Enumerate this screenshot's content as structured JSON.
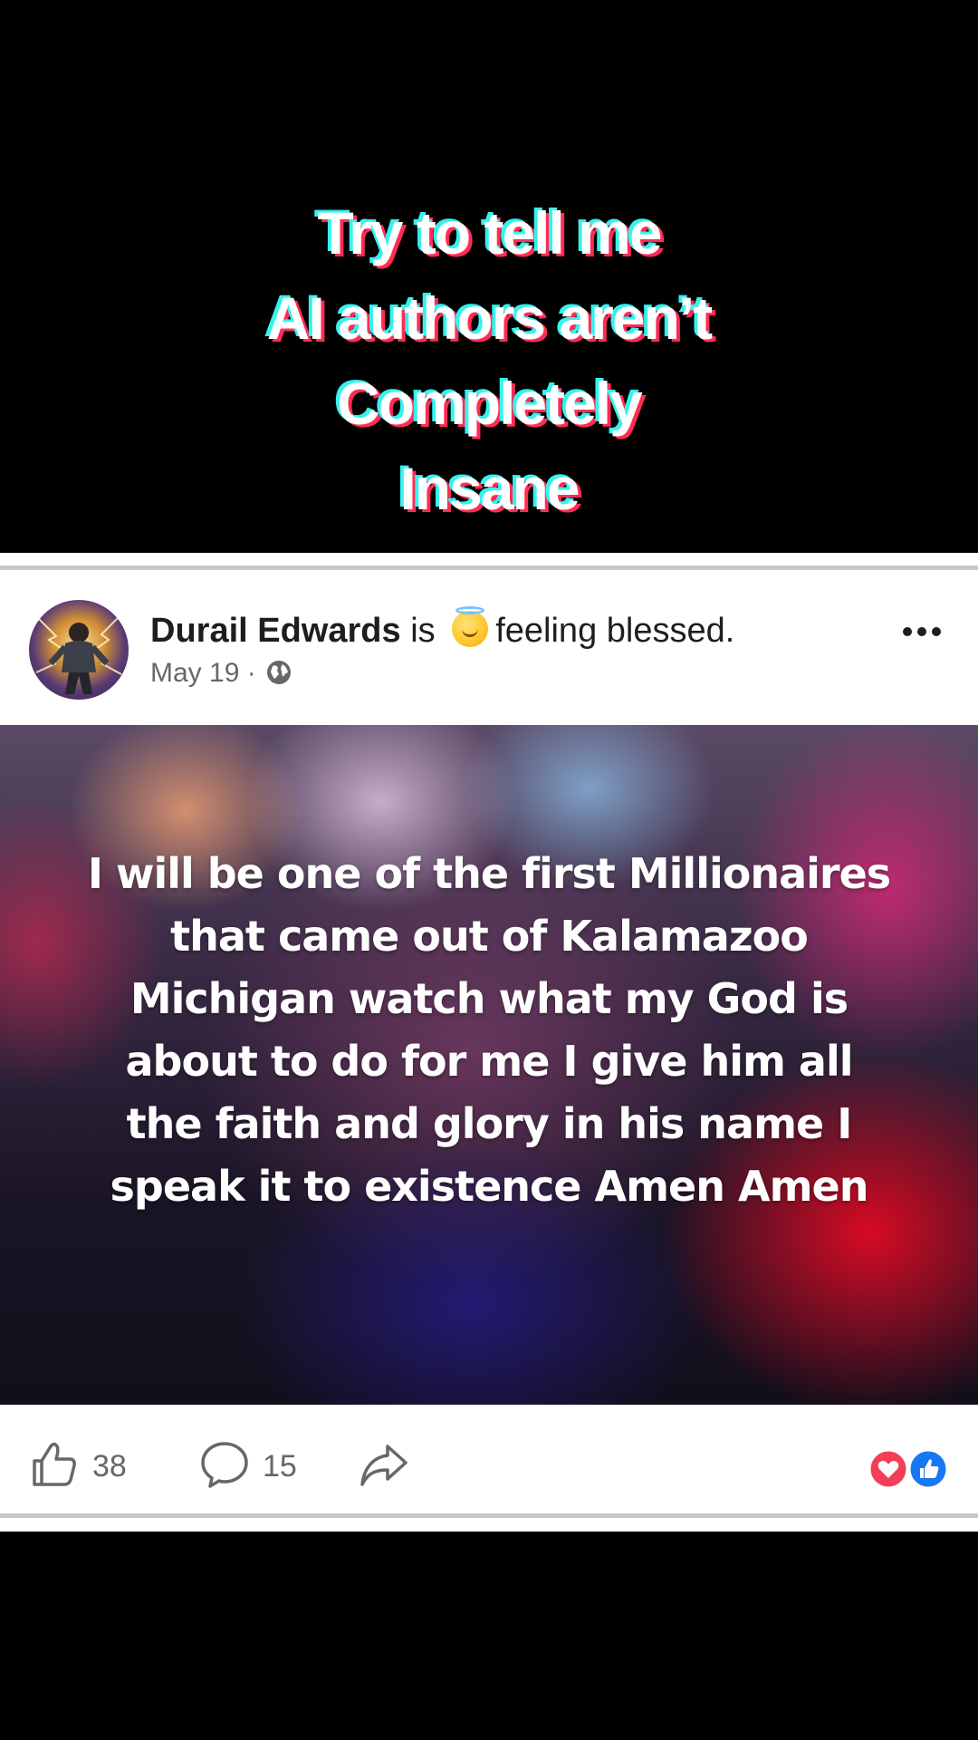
{
  "caption": {
    "lines": [
      "Try to tell me",
      "AI authors aren’t",
      "Completely",
      "Insane"
    ]
  },
  "post": {
    "author_name": "Durail Edwards",
    "verb": "is",
    "feeling_text": "feeling blessed.",
    "date": "May 19",
    "separator": "·",
    "image_text": "I will be one of the first Millionaires that came out of Kalamazoo Michigan watch what my God is about to do for me I give him all the faith and glory in his name I speak it to existence Amen Amen",
    "likes_count": "38",
    "comments_count": "15",
    "icons": {
      "feeling": "smiling-face-with-halo-icon",
      "audience": "globe-icon",
      "menu": "more-options-icon",
      "like": "thumbs-up-icon",
      "comment": "comment-bubble-icon",
      "share": "share-arrow-icon",
      "reactions": [
        "love-reaction-icon",
        "like-reaction-icon"
      ]
    },
    "colors": {
      "caption_cyan": "#35f2ee",
      "caption_red": "#fe2c55",
      "love": "#f33e58",
      "like": "#1877f2",
      "meta_gray": "#65676b"
    }
  }
}
